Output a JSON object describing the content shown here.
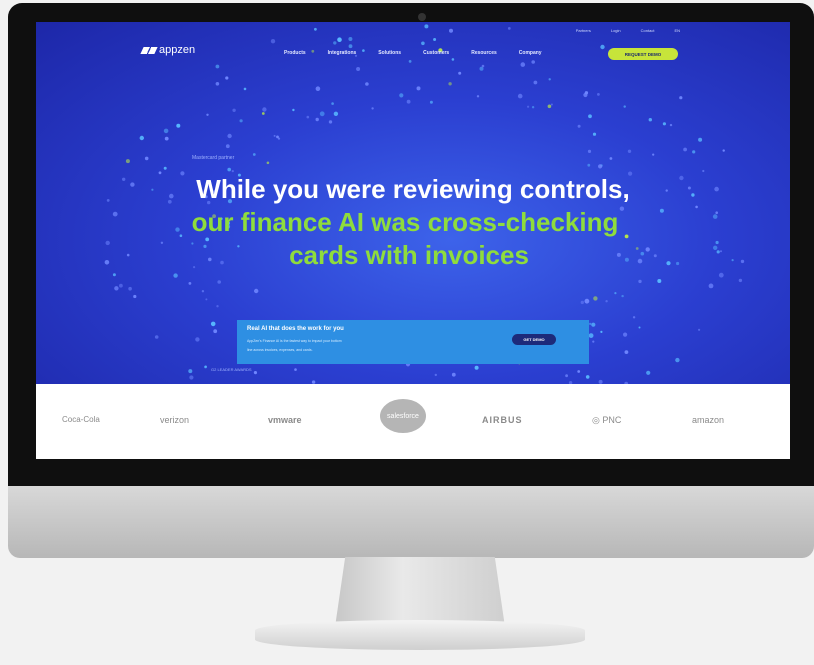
{
  "top_nav": [
    "Partners",
    "Login",
    "Contact",
    "EN"
  ],
  "logo": {
    "text": "appzen"
  },
  "nav": [
    "Products",
    "Integrations",
    "Solutions",
    "Customers",
    "Resources",
    "Company"
  ],
  "cta_label": "REQUEST DEMO",
  "hero": {
    "eyebrow": "Mastercard partner",
    "line1": "While you were reviewing controls,",
    "line2": "our finance AI was cross-checking",
    "line3": "cards with invoices"
  },
  "banner": {
    "title": "Real AI that does the work for you",
    "desc1": "AppZen's Finance AI is the fastest way to impact your bottom",
    "desc2": "line across invoices, expenses, and cards.",
    "button": "GET DEMO"
  },
  "g2_badge": "G2 LEADER AWARDS",
  "customer_logos": [
    "Coca-Cola",
    "verizon",
    "vmware",
    "salesforce",
    "AIRBUS",
    "PNC",
    "amazon"
  ]
}
